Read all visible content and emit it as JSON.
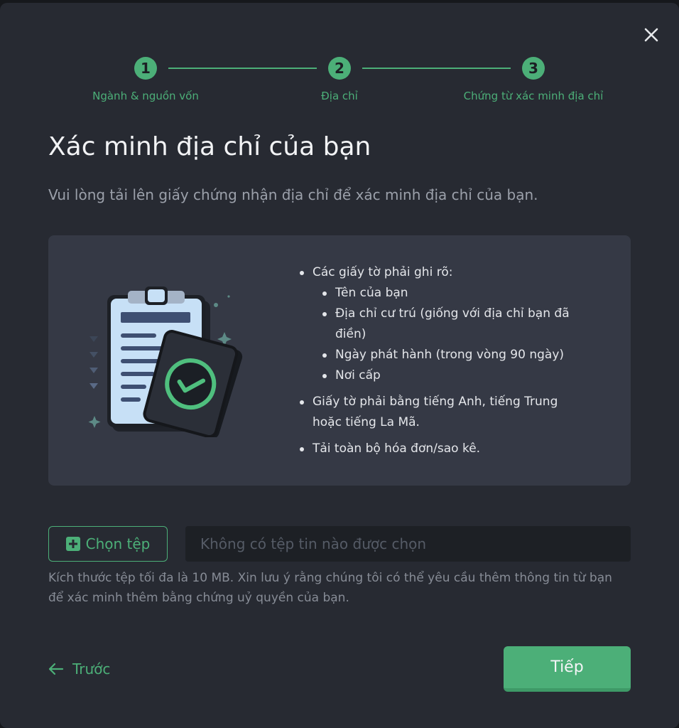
{
  "stepper": {
    "steps": [
      {
        "number": "1",
        "label": "Ngành & nguồn vốn"
      },
      {
        "number": "2",
        "label": "Địa chỉ"
      },
      {
        "number": "3",
        "label": "Chứng từ xác minh địa chỉ"
      }
    ]
  },
  "page": {
    "title": "Xác minh địa chỉ của bạn",
    "subtitle": "Vui lòng tải lên giấy chứng nhận địa chỉ để xác minh địa chỉ của bạn."
  },
  "requirements": {
    "intro": "Các giấy tờ phải ghi rõ:",
    "sub_items": [
      "Tên của bạn",
      "Địa chỉ cư trú (giống với địa chỉ bạn đã điền)",
      "Ngày phát hành (trong vòng 90 ngày)",
      "Nơi cấp"
    ],
    "language": "Giấy tờ phải bằng tiếng Anh, tiếng Trung hoặc tiếng La Mã.",
    "full_upload": "Tải toàn bộ hóa đơn/sao kê."
  },
  "upload": {
    "button_label": "Chọn tệp",
    "field_value": "Không có tệp tin nào được chọn",
    "note": "Kích thước tệp tối đa là 10 MB. Xin lưu ý rằng chúng tôi có thể yêu cầu thêm thông tin từ bạn để xác minh thêm bằng chứng uỷ quyền của bạn."
  },
  "footer": {
    "back_label": "Trước",
    "next_label": "Tiếp"
  },
  "colors": {
    "accent": "#4caf78",
    "background": "#272a32",
    "panel": "#353945"
  },
  "icons": {
    "close": "close-icon",
    "back": "arrow-left-icon",
    "add": "plus-square-icon",
    "illustration": "document-check-illustration"
  }
}
